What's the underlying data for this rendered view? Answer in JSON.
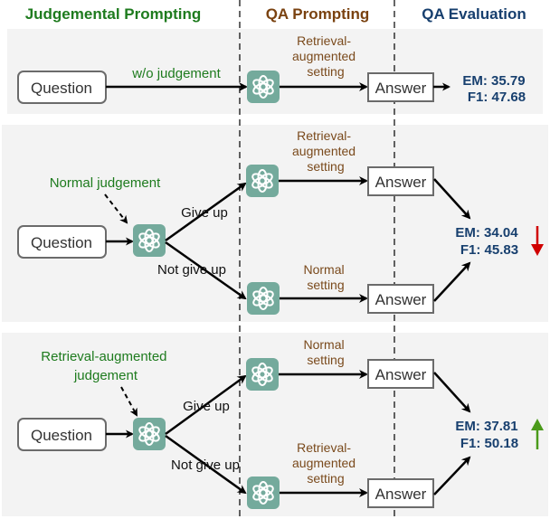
{
  "colors": {
    "judgement_green": "#1e7b1e",
    "qa_prompt_brown": "#7a4210",
    "qa_eval_navy": "#173f6e",
    "setting_brown": "#7a4a1c",
    "gpt_teal": "#74aa9c",
    "panel_bg": "#f3f3f3",
    "down_red": "#d00000",
    "up_green": "#4a9a1a"
  },
  "headers": {
    "judgemental_prompting": "Judgemental Prompting",
    "qa_prompting": "QA Prompting",
    "qa_evaluation": "QA Evaluation"
  },
  "panels": [
    {
      "question": "Question",
      "judgement_label": "w/o judgement",
      "setting_lines": [
        "Retrieval-",
        "augmented",
        "setting"
      ],
      "answer": "Answer",
      "em": "EM: 35.79",
      "f1": "F1: 47.68",
      "model_icon": "openai-logo"
    },
    {
      "question": "Question",
      "judgement_label": "Normal judgement",
      "give_up": "Give up",
      "not_give_up": "Not give up",
      "top_setting_lines": [
        "Retrieval-",
        "augmented",
        "setting"
      ],
      "bottom_setting_lines": [
        "Normal",
        "setting"
      ],
      "answer_top": "Answer",
      "answer_bottom": "Answer",
      "em": "EM: 34.04",
      "f1": "F1: 45.83",
      "trend": "down",
      "trend_icon": "arrow-down"
    },
    {
      "question": "Question",
      "judgement_lines": [
        "Retrieval-augmented",
        "judgement"
      ],
      "give_up": "Give up",
      "not_give_up": "Not give up",
      "top_setting_lines": [
        "Normal",
        "setting"
      ],
      "bottom_setting_lines": [
        "Retrieval-",
        "augmented",
        "setting"
      ],
      "answer_top": "Answer",
      "answer_bottom": "Answer",
      "em": "EM: 37.81",
      "f1": "F1: 50.18",
      "trend": "up",
      "trend_icon": "arrow-up"
    }
  ]
}
